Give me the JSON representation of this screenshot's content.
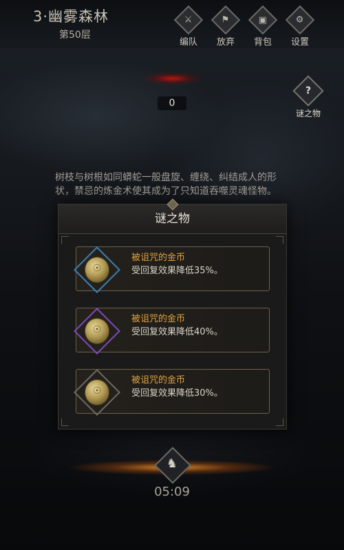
{
  "header": {
    "stage_title": "3·幽雾森林",
    "floor": "第50层",
    "buttons": [
      {
        "label": "编队",
        "icon": "formation-icon",
        "glyph": "⚔"
      },
      {
        "label": "放弃",
        "icon": "abandon-icon",
        "glyph": "⚑"
      },
      {
        "label": "背包",
        "icon": "backpack-icon",
        "glyph": "▣"
      },
      {
        "label": "设置",
        "icon": "settings-icon",
        "glyph": "⚙"
      }
    ]
  },
  "counter_value": "0",
  "mystery_button": {
    "label": "谜之物",
    "glyph": "?"
  },
  "story_text": "树枝与树根如同蟒蛇一般盘旋、缠绕、纠结成人的形状，禁忌的炼金术使其成为了只知道吞噬灵魂怪物。",
  "modal": {
    "title": "谜之物",
    "items": [
      {
        "name": "被诅咒的金币",
        "desc": "受回复效果降低35%。",
        "rarity": "blue"
      },
      {
        "name": "被诅咒的金币",
        "desc": "受回复效果降低40%。",
        "rarity": "purple"
      },
      {
        "name": "被诅咒的金币",
        "desc": "受回复效果降低30%。",
        "rarity": "grey"
      }
    ]
  },
  "timer": "05:09",
  "colors": {
    "item_name": "#e2a23c",
    "rarity_blue": "#3d7fb0",
    "rarity_purple": "#7c4bb8",
    "rarity_grey": "#6c6a66"
  }
}
